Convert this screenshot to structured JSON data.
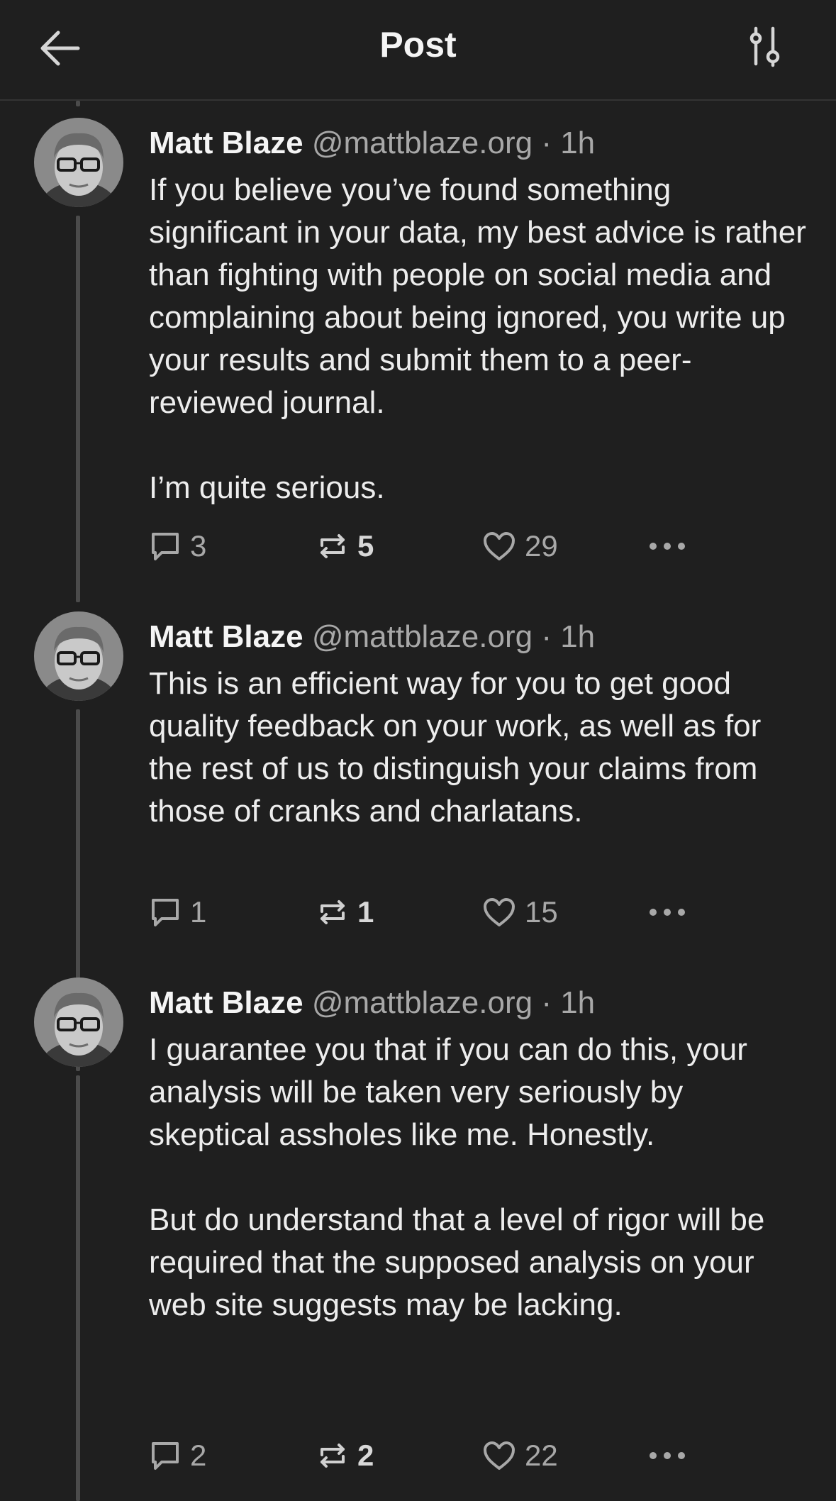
{
  "header": {
    "title": "Post",
    "back_icon": "arrow-left-icon",
    "settings_icon": "sliders-icon"
  },
  "posts": [
    {
      "author": "Matt Blaze",
      "handle": "@mattblaze.org",
      "sep": "·",
      "time": "1h",
      "paragraphs": [
        "If you believe you’ve found something significant in your data, my best advice is rather than fighting with people on social media and complaining about being ignored, you write up your results and submit them to a peer-reviewed journal.",
        "I’m quite serious."
      ],
      "replies": "3",
      "reposts": "5",
      "likes": "29"
    },
    {
      "author": "Matt Blaze",
      "handle": "@mattblaze.org",
      "sep": "·",
      "time": "1h",
      "paragraphs": [
        "This is an efficient way for you to get good quality feedback on your work, as well as for the rest of us to distinguish your claims from those of cranks and charlatans."
      ],
      "replies": "1",
      "reposts": "1",
      "likes": "15"
    },
    {
      "author": "Matt Blaze",
      "handle": "@mattblaze.org",
      "sep": "·",
      "time": "1h",
      "paragraphs": [
        "I guarantee you that if you can do this, your analysis will be taken very seriously by skeptical assholes like me. Honestly.",
        "But do understand that a level of rigor will be required that the supposed analysis on your web site suggests may be lacking."
      ],
      "replies": "2",
      "reposts": "2",
      "likes": "22"
    }
  ],
  "colors": {
    "background": "#1f1f1f",
    "text": "#ededed",
    "muted": "#a8a8a8",
    "thread_line": "#4b4b4b"
  }
}
